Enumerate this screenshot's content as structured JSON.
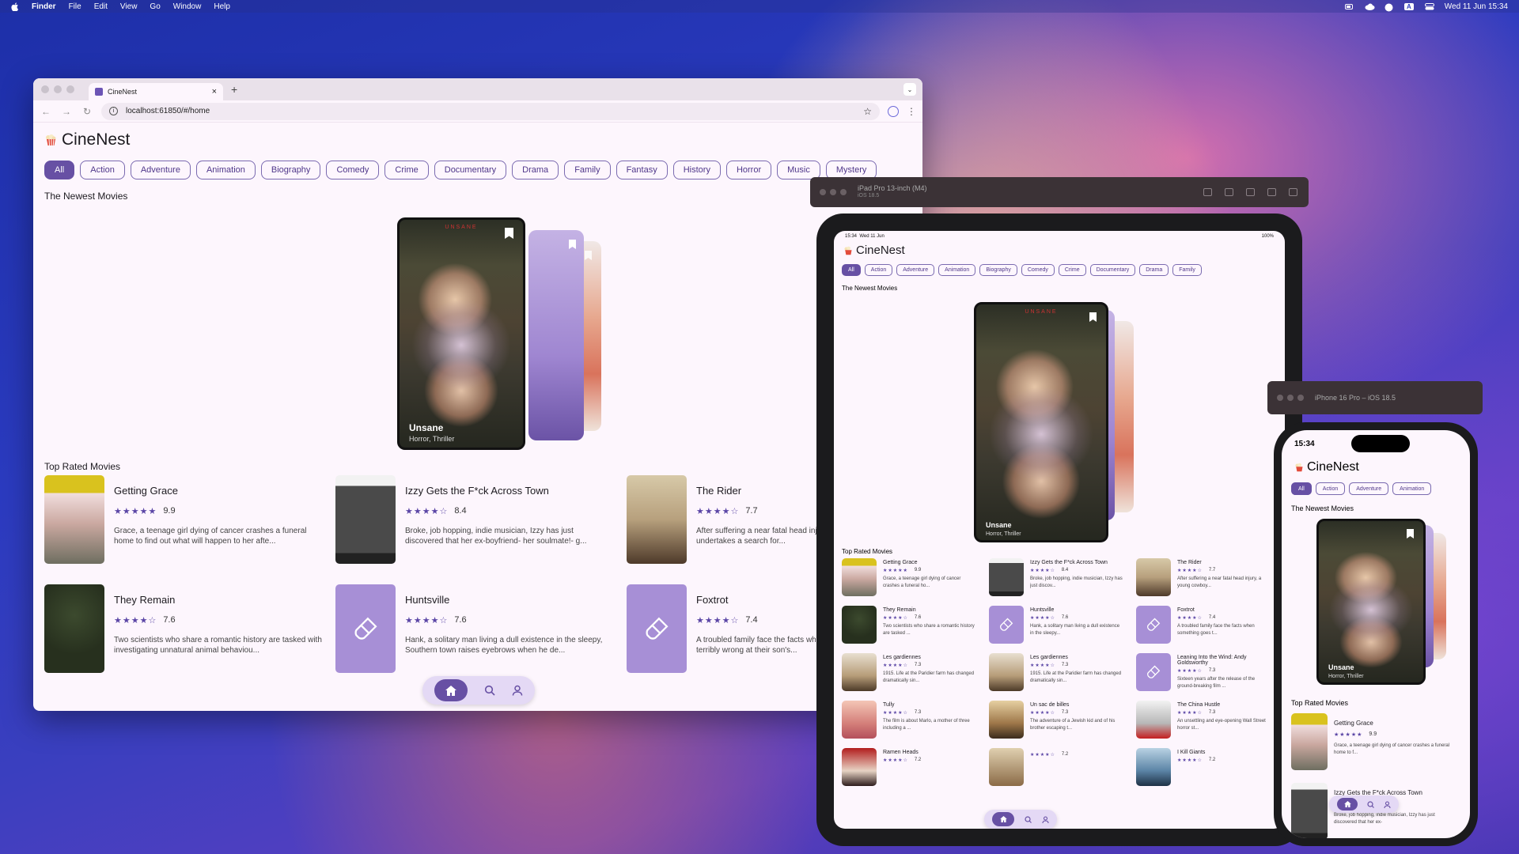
{
  "menubar": {
    "app": "Finder",
    "items": [
      "File",
      "Edit",
      "View",
      "Go",
      "Window",
      "Help"
    ],
    "datetime": "Wed 11 Jun  15:34"
  },
  "browser": {
    "tab_title": "CineNest",
    "url": "localhost:61850/#/home"
  },
  "app": {
    "title": "CineNest",
    "newest_heading": "The Newest Movies",
    "top_heading": "Top Rated Movies"
  },
  "genres": [
    "All",
    "Action",
    "Adventure",
    "Animation",
    "Biography",
    "Comedy",
    "Crime",
    "Documentary",
    "Drama",
    "Family",
    "Fantasy",
    "History",
    "Horror",
    "Music",
    "Mystery"
  ],
  "featured": {
    "title": "Unsane",
    "genres": "Horror, Thriller"
  },
  "movies": [
    {
      "title": "Getting Grace",
      "stars": "★★★★★",
      "rating": "9.9",
      "desc": "Grace, a teenage girl dying of cancer crashes a funeral home to find out what will happen to her afte...",
      "art": "grace"
    },
    {
      "title": "Izzy Gets the F*ck Across Town",
      "stars": "★★★★☆",
      "rating": "8.4",
      "desc": "Broke, job hopping, indie musician, Izzy has just discovered that her ex-boyfriend- her soulmate!- g...",
      "art": "izzy"
    },
    {
      "title": "The Rider",
      "stars": "★★★★☆",
      "rating": "7.7",
      "desc": "After suffering a near fatal head injury, a young cowboy undertakes a search for...",
      "art": "rider"
    },
    {
      "title": "They Remain",
      "stars": "★★★★☆",
      "rating": "7.6",
      "desc": "Two scientists who share a romantic history are tasked with investigating unnatural animal behaviou...",
      "art": "remain"
    },
    {
      "title": "Huntsville",
      "stars": "★★★★☆",
      "rating": "7.6",
      "desc": "Hank, a solitary man living a dull existence in the sleepy, Southern town raises eyebrows when he de...",
      "art": "ph"
    },
    {
      "title": "Foxtrot",
      "stars": "★★★★☆",
      "rating": "7.4",
      "desc": "A troubled family face the facts when something goes terribly wrong at their son's...",
      "art": "ph"
    }
  ],
  "ipad": {
    "sim_title": "iPad Pro 13-inch (M4)",
    "sim_sub": "iOS 18.5",
    "time": "15:34",
    "date": "Wed 11 Jun",
    "battery": "100%",
    "chips": [
      "All",
      "Action",
      "Adventure",
      "Animation",
      "Biography",
      "Comedy",
      "Crime",
      "Documentary",
      "Drama",
      "Family"
    ],
    "movies": [
      {
        "title": "Getting Grace",
        "stars": "★★★★★",
        "rating": "9.9",
        "desc": "Grace, a teenage girl dying of cancer crashes a funeral ho...",
        "art": "grace"
      },
      {
        "title": "Izzy Gets the F*ck Across Town",
        "stars": "★★★★☆",
        "rating": "8.4",
        "desc": "Broke, job hopping, indie musician, Izzy has just discov...",
        "art": "izzy"
      },
      {
        "title": "The Rider",
        "stars": "★★★★☆",
        "rating": "7.7",
        "desc": "After suffering a near fatal head injury, a young cowboy...",
        "art": "rider"
      },
      {
        "title": "They Remain",
        "stars": "★★★★☆",
        "rating": "7.6",
        "desc": "Two scientists who share a romantic history are tasked ...",
        "art": "remain"
      },
      {
        "title": "Huntsville",
        "stars": "★★★★☆",
        "rating": "7.6",
        "desc": "Hank, a solitary man living a dull existence in the sleepy...",
        "art": "ph"
      },
      {
        "title": "Foxtrot",
        "stars": "★★★★☆",
        "rating": "7.4",
        "desc": "A troubled family face the facts when something goes t...",
        "art": "ph"
      },
      {
        "title": "Les gardiennes",
        "stars": "★★★★☆",
        "rating": "7.3",
        "desc": "1915. Life at the Paridier farm has changed dramatically sin...",
        "art": "garden"
      },
      {
        "title": "Les gardiennes",
        "stars": "★★★★☆",
        "rating": "7.3",
        "desc": "1915. Life at the Paridier farm has changed dramatically sin...",
        "art": "garden"
      },
      {
        "title": "Leaning Into the Wind: Andy Goldsworthy",
        "stars": "★★★★☆",
        "rating": "7.3",
        "desc": "Sixteen years after the release of the ground-breaking film ...",
        "art": "ph"
      },
      {
        "title": "Tully",
        "stars": "★★★★☆",
        "rating": "7.3",
        "desc": "The film is about Marlo, a mother of three including a ...",
        "art": "tully"
      },
      {
        "title": "Un sac de billes",
        "stars": "★★★★☆",
        "rating": "7.3",
        "desc": "The adventure of a Jewish kid and of his brother escaping t...",
        "art": "sac"
      },
      {
        "title": "The China Hustle",
        "stars": "★★★★☆",
        "rating": "7.3",
        "desc": "An unsettling and eye-opening Wall Street horror st...",
        "art": "china"
      },
      {
        "title": "Ramen Heads",
        "stars": "★★★★☆",
        "rating": "7.2",
        "desc": "",
        "art": "ramen"
      },
      {
        "title": "",
        "stars": "★★★★☆",
        "rating": "7.2",
        "desc": "",
        "art": "unsac2"
      },
      {
        "title": "I Kill Giants",
        "stars": "★★★★☆",
        "rating": "7.2",
        "desc": "",
        "art": "giants"
      }
    ]
  },
  "iphone": {
    "sim_title": "iPhone 16 Pro – iOS 18.5",
    "time": "15:34",
    "chips": [
      "All",
      "Action",
      "Adventure",
      "Animation"
    ],
    "movies": [
      {
        "title": "Getting Grace",
        "stars": "★★★★★",
        "rating": "9.9",
        "desc": "Grace, a teenage girl dying of cancer crashes a funeral home to f...",
        "art": "grace"
      },
      {
        "title": "Izzy Gets the F*ck Across Town",
        "stars": "★★★★☆",
        "rating": "8.4",
        "desc": "Broke, job hopping, indie musician, Izzy has just discovered that her ex-",
        "art": "izzy"
      }
    ]
  },
  "colors": {
    "primary": "#6750a4",
    "surface": "#fdf6fd",
    "placeholder": "#a78fd6"
  },
  "icons": [
    "apple-icon",
    "home-icon",
    "search-icon",
    "person-icon",
    "bookmark-icon",
    "brush-icon",
    "star-icon",
    "popcorn-icon"
  ]
}
